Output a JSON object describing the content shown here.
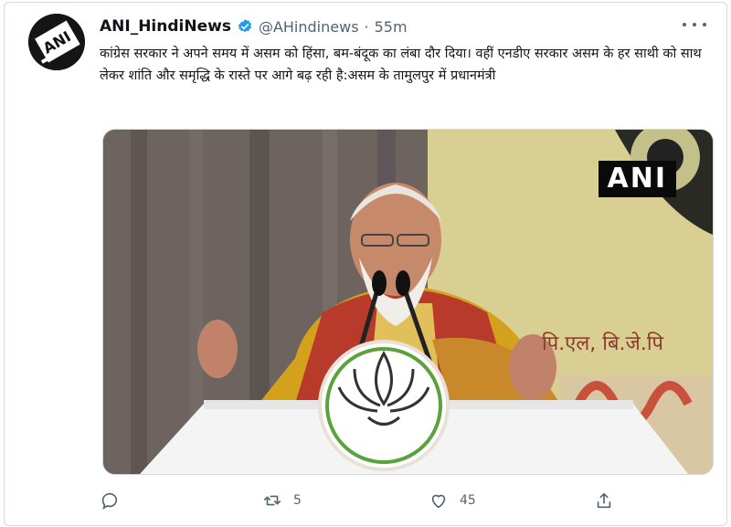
{
  "tweet": {
    "display_name": "ANI_HindiNews",
    "handle": "@AHindinews",
    "separator": "·",
    "time": "55m",
    "avatar_text": "ANI",
    "verified_icon": "verified-badge-icon",
    "text": "कांग्रेस सरकार ने अपने समय में असम को हिंसा, बम-बंदूक का लंबा दौर दिया। वहीं एनडीए सरकार असम के हर साथी को साथ लेकर शांति और समृद्धि के रास्ते पर आगे बढ़ रही है:असम के तामुलपुर में प्रधानमंत्री"
  },
  "media": {
    "watermark": "ANI",
    "banner_text": "पि.एल, बि.जे.पि"
  },
  "actions": {
    "reply": {
      "icon": "reply-icon",
      "count": ""
    },
    "retweet": {
      "icon": "retweet-icon",
      "count": "5"
    },
    "like": {
      "icon": "heart-icon",
      "count": "45"
    },
    "share": {
      "icon": "share-icon",
      "count": ""
    }
  },
  "colors": {
    "verified": "#1d9bf0",
    "muted": "#536471",
    "border": "#cfd9de"
  }
}
